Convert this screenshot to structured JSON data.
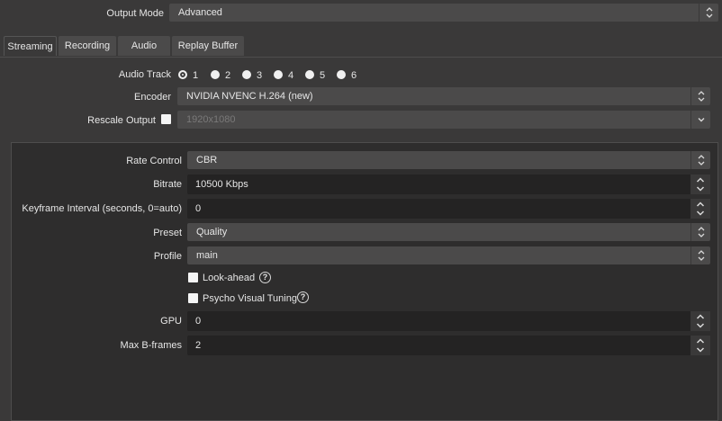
{
  "output_mode": {
    "label": "Output Mode",
    "value": "Advanced"
  },
  "tabs": [
    {
      "label": "Streaming"
    },
    {
      "label": "Recording"
    },
    {
      "label": "Audio"
    },
    {
      "label": "Replay Buffer"
    }
  ],
  "audio_track": {
    "label": "Audio Track",
    "options": [
      "1",
      "2",
      "3",
      "4",
      "5",
      "6"
    ],
    "selected": "1"
  },
  "encoder": {
    "label": "Encoder",
    "value": "NVIDIA NVENC H.264 (new)"
  },
  "rescale_output": {
    "label": "Rescale Output",
    "value": "1920x1080",
    "checked": false
  },
  "settings": {
    "rate_control": {
      "label": "Rate Control",
      "value": "CBR"
    },
    "bitrate": {
      "label": "Bitrate",
      "value": "10500 Kbps"
    },
    "keyframe": {
      "label": "Keyframe Interval (seconds, 0=auto)",
      "value": "0"
    },
    "preset": {
      "label": "Preset",
      "value": "Quality"
    },
    "profile": {
      "label": "Profile",
      "value": "main"
    },
    "look_ahead": {
      "label": "Look-ahead",
      "checked": false
    },
    "psycho_visual": {
      "label": "Psycho Visual Tuning",
      "checked": false
    },
    "gpu": {
      "label": "GPU",
      "value": "0"
    },
    "max_bframes": {
      "label": "Max B-frames",
      "value": "2"
    }
  },
  "colors": {
    "background": "#3a3939",
    "panel": "#2e2d2d",
    "combo": "#4b4a4a",
    "spin": "#242323"
  }
}
